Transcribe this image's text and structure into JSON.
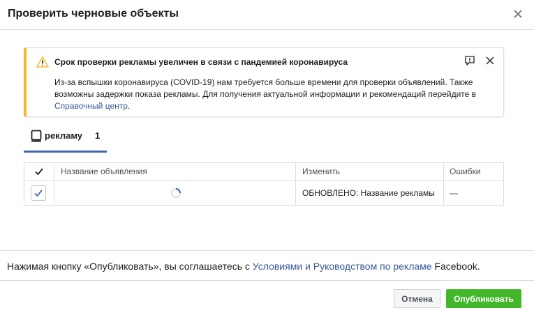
{
  "dialog": {
    "title": "Проверить черновые объекты"
  },
  "banner": {
    "title": "Срок проверки рекламы увеличен в связи с пандемией коронавируса",
    "text": "Из-за вспышки коронавируса (COVID-19) нам требуется больше времени для проверки объявлений. Также возможны задержки показа рекламы. Для получения актуальной информации и рекомендаций перейдите в ",
    "link": "Справочный центр",
    "suffix": "."
  },
  "tab": {
    "label": "рекламу",
    "count": "1"
  },
  "table": {
    "headers": [
      "Название объявления",
      "Изменить",
      "Ошибки"
    ],
    "rows": [
      {
        "change": "ОБНОВЛЕНО: Название рекламы",
        "errors": "—"
      }
    ]
  },
  "footer": {
    "consent_prefix": "Нажимая кнопку «Опубликовать», вы соглашаетесь с ",
    "consent_link": "Условиями и Руководством по рекламе",
    "consent_suffix": " Facebook."
  },
  "buttons": {
    "cancel": "Отмена",
    "publish": "Опубликовать"
  },
  "colors": {
    "accent": "#4267b2",
    "warning": "#f7b928",
    "publish": "#42b72a",
    "link": "#385898"
  }
}
